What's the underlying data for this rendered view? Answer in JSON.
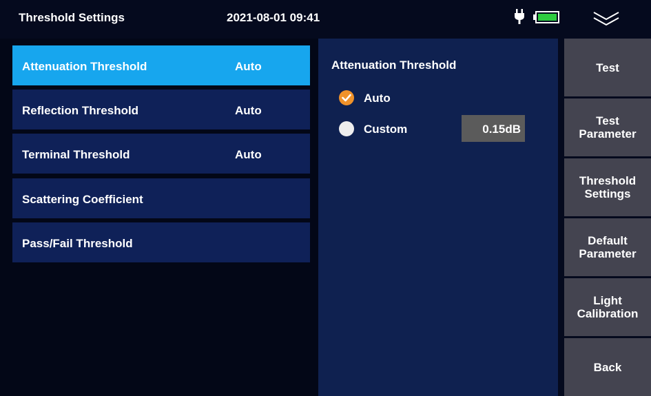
{
  "status_bar": {
    "title": "Threshold Settings",
    "datetime": "2021-08-01 09:41",
    "icons": [
      "plug-icon",
      "battery-icon",
      "chevron-down-icon"
    ],
    "battery_color": "#2ecc40"
  },
  "menu": {
    "items": [
      {
        "label": "Attenuation Threshold",
        "value": "Auto",
        "active": true
      },
      {
        "label": "Reflection Threshold",
        "value": "Auto"
      },
      {
        "label": "Terminal Threshold",
        "value": "Auto"
      },
      {
        "label": "Scattering Coefficient",
        "value": ""
      },
      {
        "label": "Pass/Fail Threshold",
        "value": ""
      }
    ]
  },
  "detail": {
    "title": "Attenuation Threshold",
    "options": [
      {
        "label": "Auto",
        "selected": true
      },
      {
        "label": "Custom",
        "selected": false
      }
    ],
    "custom_value": "0.15dB"
  },
  "side_nav": {
    "buttons": [
      "Test",
      "Test\nParameter",
      "Threshold\nSettings",
      "Default\nParameter",
      "Light\nCalibration",
      "Back"
    ]
  },
  "colors": {
    "active_item": "#17a6ee",
    "menu_item": "#0f2158",
    "panel": "#0f2150",
    "nav_button": "#444450",
    "radio_checked": "#f0922a"
  }
}
